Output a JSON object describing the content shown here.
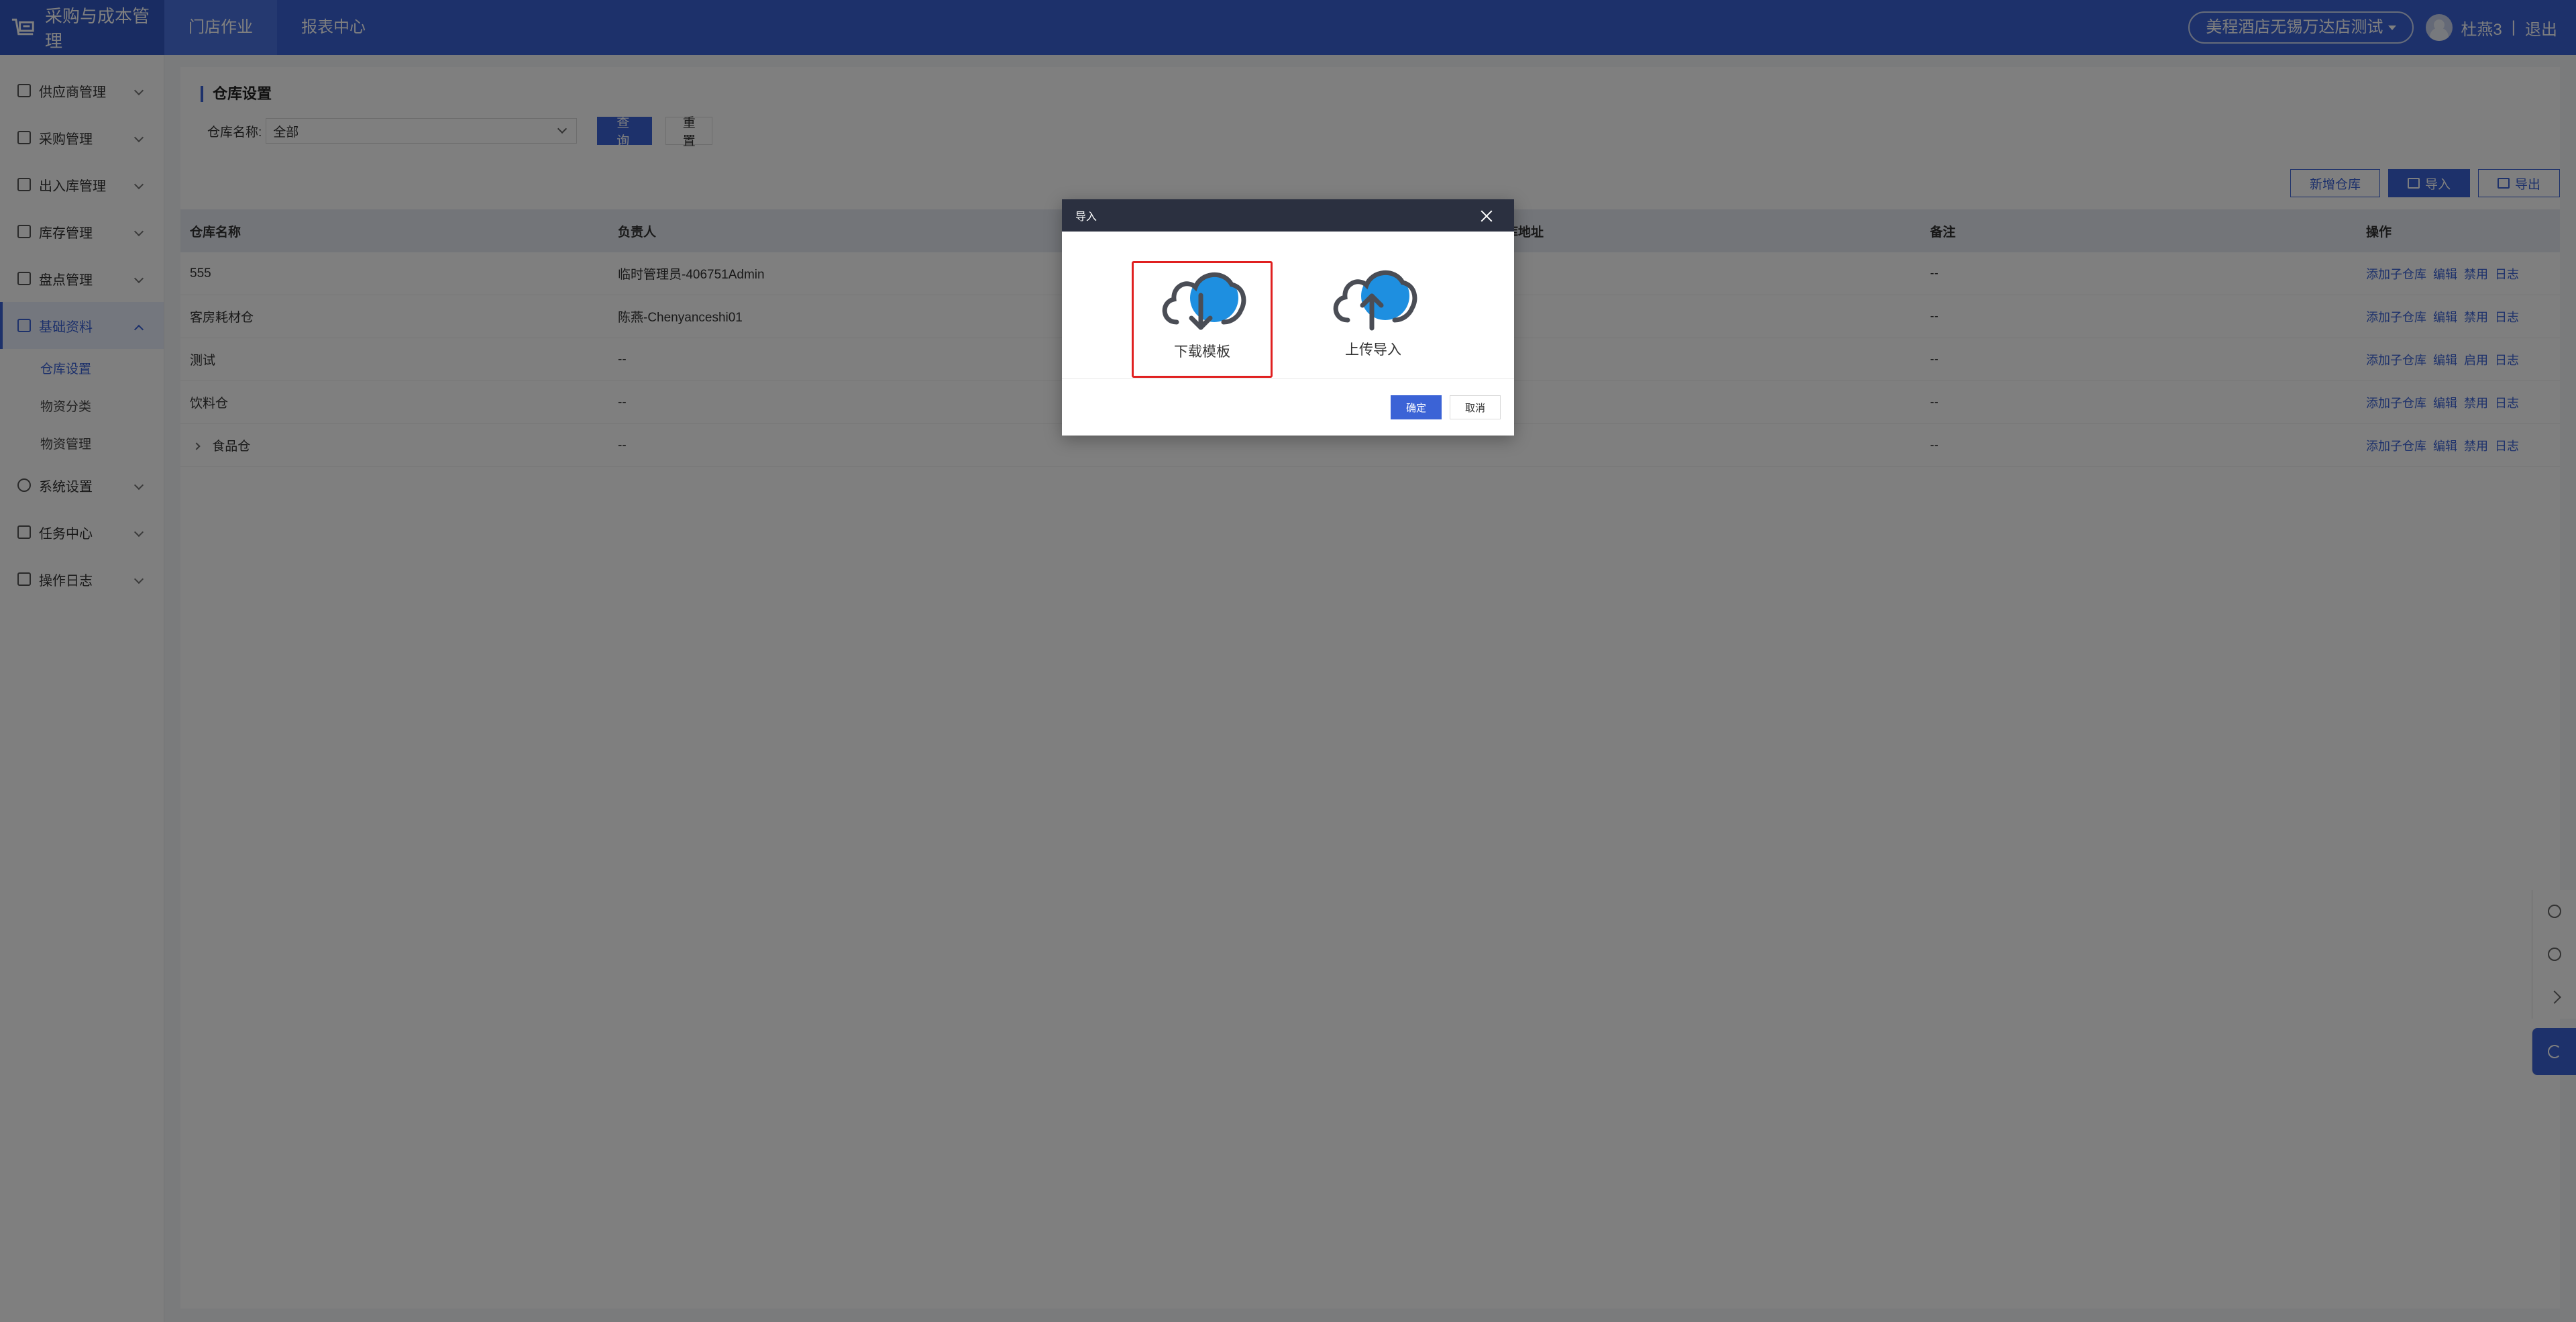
{
  "app": {
    "title": "采购与成本管理",
    "top_nav": [
      "门店作业",
      "报表中心"
    ],
    "store": "美程酒店无锡万达店测试",
    "user": "杜燕3",
    "separator": "|",
    "logout": "退出"
  },
  "sidebar": {
    "items": [
      {
        "label": "供应商管理"
      },
      {
        "label": "采购管理"
      },
      {
        "label": "出入库管理"
      },
      {
        "label": "库存管理"
      },
      {
        "label": "盘点管理"
      },
      {
        "label": "基础资料"
      },
      {
        "label": "系统设置"
      },
      {
        "label": "任务中心"
      },
      {
        "label": "操作日志"
      }
    ],
    "sub_items": [
      {
        "label": "仓库设置"
      },
      {
        "label": "物资分类"
      },
      {
        "label": "物资管理"
      }
    ]
  },
  "page": {
    "title": "仓库设置",
    "filter_label": "仓库名称:",
    "filter_value": "全部",
    "query_btn": "查询",
    "reset_btn": "重置",
    "new_btn": "新增仓库",
    "import_btn": "导入",
    "export_btn": "导出"
  },
  "table": {
    "headers": [
      "仓库名称",
      "负责人",
      "",
      "仓库地址",
      "备注",
      "操作"
    ],
    "rows": [
      {
        "name": "555",
        "manager": "临时管理员-406751Admin",
        "address": "",
        "note": "--",
        "ops": [
          "添加子仓库",
          "编辑",
          "禁用",
          "日志"
        ]
      },
      {
        "name": "客房耗材仓",
        "manager": "陈燕-Chenyanceshi01",
        "address": "",
        "note": "--",
        "ops": [
          "添加子仓库",
          "编辑",
          "禁用",
          "日志"
        ]
      },
      {
        "name": "测试",
        "manager": "--",
        "address": "",
        "note": "--",
        "ops": [
          "添加子仓库",
          "编辑",
          "启用",
          "日志"
        ]
      },
      {
        "name": "饮料仓",
        "manager": "--",
        "address": "",
        "note": "--",
        "ops": [
          "添加子仓库",
          "编辑",
          "禁用",
          "日志"
        ]
      },
      {
        "name": "食品仓",
        "manager": "--",
        "address": "",
        "note": "--",
        "ops": [
          "添加子仓库",
          "编辑",
          "禁用",
          "日志"
        ]
      }
    ]
  },
  "modal": {
    "title": "导入",
    "download_label": "下载模板",
    "upload_label": "上传导入",
    "confirm": "确定",
    "cancel": "取消"
  },
  "colors": {
    "primary": "#3b63d6",
    "modal_header": "#2b3040",
    "cloud_blue": "#1e8fe0",
    "cloud_outline": "#4a4d55",
    "selection": "#e02020"
  }
}
